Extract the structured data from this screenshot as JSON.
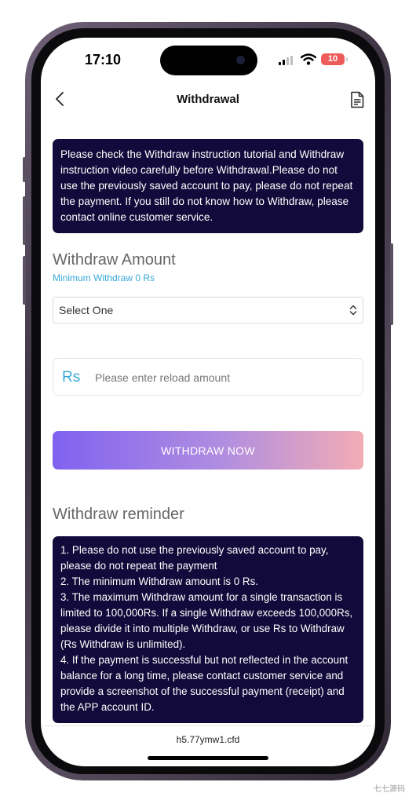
{
  "status_bar": {
    "time": "17:10",
    "battery": "10"
  },
  "header": {
    "title": "Withdrawal"
  },
  "notice": {
    "text": "Please check the Withdraw instruction tutorial and Withdraw instruction video carefully before Withdrawal.Please do not use the previously saved account to pay, please do not repeat the payment. If you still do not know how to Withdraw, please contact online customer service."
  },
  "withdraw_amount": {
    "title": "Withdraw Amount",
    "minimum": "Minimum Withdraw 0 Rs",
    "select_value": "Select One",
    "currency": "Rs",
    "placeholder": "Please enter reload amount",
    "button_label": "WITHDRAW NOW"
  },
  "reminder": {
    "title": "Withdraw reminder",
    "items": [
      "1. Please do not use the previously saved account to pay, please do not repeat the payment",
      "2. The minimum Withdraw amount is 0 Rs.",
      "3. The maximum Withdraw amount for a single transaction is limited to 100,000Rs. If a single Withdraw exceeds 100,000Rs, please divide it into multiple Withdraw, or use Rs to Withdraw (Rs Withdraw is unlimited).",
      "4. If the payment is successful but not reflected in the account balance for a long time, please contact customer service and provide a screenshot of the successful payment (receipt) and the APP account ID."
    ]
  },
  "browser": {
    "url": "h5.77ymw1.cfd"
  },
  "watermark": "七七源码",
  "colors": {
    "notice_bg": "#120a3a",
    "accent": "#36a9d8",
    "button_start": "#8062f0",
    "button_end": "#f2acb4"
  },
  "icons": [
    "back-icon",
    "document-icon",
    "chevron-updown-icon",
    "signal-icon",
    "wifi-icon",
    "battery-icon"
  ]
}
